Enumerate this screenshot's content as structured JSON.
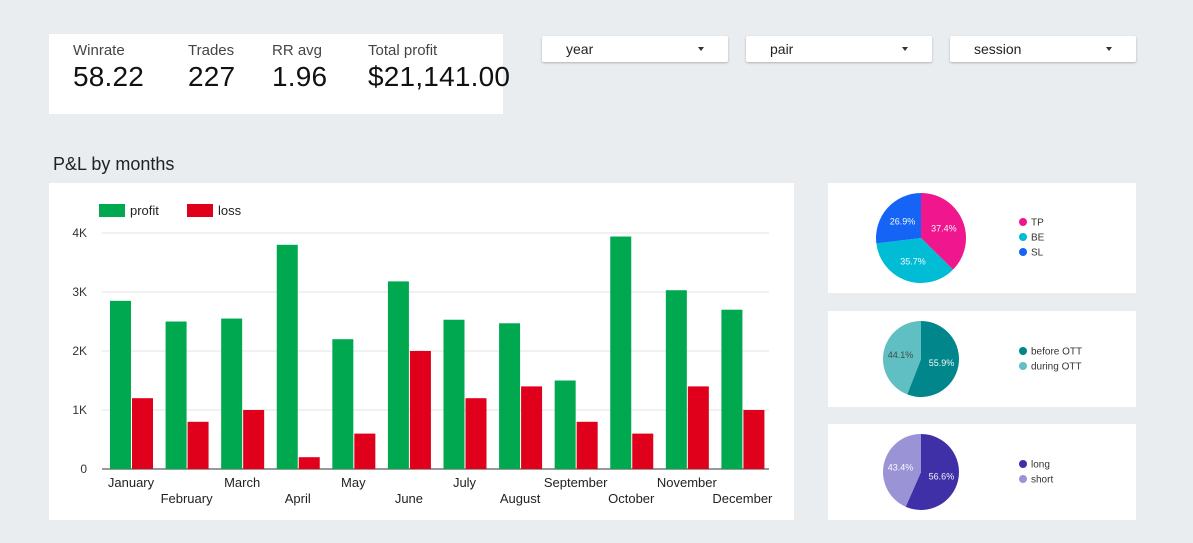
{
  "kpis": [
    {
      "label": "Winrate",
      "value": "58.22"
    },
    {
      "label": "Trades",
      "value": "227"
    },
    {
      "label": "RR avg",
      "value": "1.96"
    },
    {
      "label": "Total profit",
      "value": "$21,141.00"
    }
  ],
  "filters": [
    {
      "label": "year"
    },
    {
      "label": "pair"
    },
    {
      "label": "session"
    }
  ],
  "chart_title": "P&L by months",
  "colors": {
    "profit": "#00a94f",
    "loss": "#e0001b"
  },
  "chart_data": [
    {
      "type": "bar",
      "title": "P&L by months",
      "categories": [
        "January",
        "February",
        "March",
        "April",
        "May",
        "June",
        "July",
        "August",
        "September",
        "October",
        "November",
        "December"
      ],
      "series": [
        {
          "name": "profit",
          "color": "#00a94f",
          "values": [
            2850,
            2500,
            2550,
            3800,
            2200,
            3180,
            2530,
            2470,
            1500,
            3940,
            3030,
            2700
          ]
        },
        {
          "name": "loss",
          "color": "#e0001b",
          "values": [
            1200,
            800,
            1000,
            200,
            600,
            2000,
            1200,
            1400,
            800,
            600,
            1400,
            1000
          ]
        }
      ],
      "yticks": [
        "0",
        "1K",
        "2K",
        "3K",
        "4K"
      ],
      "ylim": [
        0,
        4000
      ],
      "grid": true,
      "legend": "top-left"
    },
    {
      "type": "pie",
      "slices": [
        {
          "label": "TP",
          "value": 37.4,
          "text": "37.4%",
          "color": "#f0168e"
        },
        {
          "label": "BE",
          "value": 35.7,
          "text": "35.7%",
          "color": "#00bcd4"
        },
        {
          "label": "SL",
          "value": 26.9,
          "text": "26.9%",
          "color": "#1564f5"
        }
      ]
    },
    {
      "type": "pie",
      "slices": [
        {
          "label": "before OTT",
          "value": 55.9,
          "text": "55.9%",
          "color": "#00868b"
        },
        {
          "label": "during OTT",
          "value": 44.1,
          "text": "44.1%",
          "color": "#5fbfc2"
        }
      ]
    },
    {
      "type": "pie",
      "slices": [
        {
          "label": "long",
          "value": 56.6,
          "text": "56.6%",
          "color": "#4030a8"
        },
        {
          "label": "short",
          "value": 43.4,
          "text": "43.4%",
          "color": "#9a93d6"
        }
      ]
    }
  ]
}
